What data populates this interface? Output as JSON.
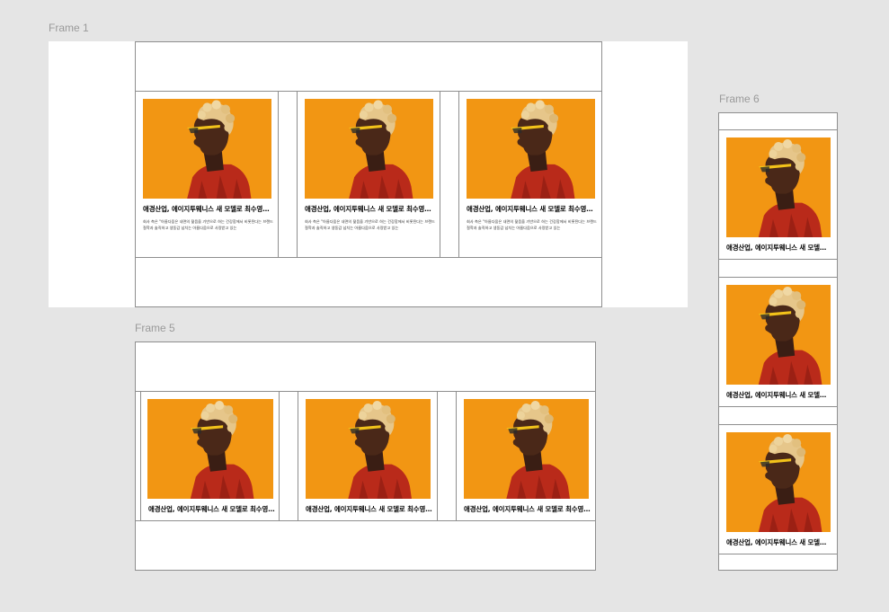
{
  "canvas": {
    "background": "#e5e5e5",
    "label_color": "#9a9a9a",
    "border_color": "#8e8e8e"
  },
  "frames": {
    "frame1": {
      "label": "Frame 1",
      "cards": [
        {
          "image": "person-profile-orange-background",
          "title": "애경산업, 에이지투웨니스 새 모델로 최수영…",
          "description": "회사 측은 \"아름다움은 내면의 젊음을 기반으로 하는 건강함에서 비롯된다는 브랜드 철학과 솔직하고 생동감 넘치는 아름다움으로 사랑받고 있는"
        },
        {
          "image": "person-profile-orange-background",
          "title": "애경산업, 에이지투웨니스 새 모델로 최수영…",
          "description": "회사 측은 \"아름다움은 내면의 젊음을 기반으로 하는 건강함에서 비롯된다는 브랜드 철학과 솔직하고 생동감 넘치는 아름다움으로 사랑받고 있는"
        },
        {
          "image": "person-profile-orange-background",
          "title": "애경산업, 에이지투웨니스 새 모델로 최수영…",
          "description": "회사 측은 \"아름다움은 내면의 젊음을 기반으로 하는 건강함에서 비롯된다는 브랜드 철학과 솔직하고 생동감 넘치는 아름다움으로 사랑받고 있는"
        }
      ]
    },
    "frame5": {
      "label": "Frame 5",
      "cards": [
        {
          "image": "person-profile-orange-background",
          "title": "애경산업, 에이지투웨니스 새 모델로 최수영…"
        },
        {
          "image": "person-profile-orange-background",
          "title": "애경산업, 에이지투웨니스 새 모델로 최수영…"
        },
        {
          "image": "person-profile-orange-background",
          "title": "애경산업, 에이지투웨니스 새 모델로 최수영…"
        }
      ]
    },
    "frame6": {
      "label": "Frame 6",
      "cards": [
        {
          "image": "person-profile-orange-background",
          "title": "애경산업, 에이지투웨니스 새 모델…"
        },
        {
          "image": "person-profile-orange-background",
          "title": "애경산업, 에이지투웨니스 새 모델…"
        },
        {
          "image": "person-profile-orange-background",
          "title": "애경산업, 에이지투웨니스 새 모델…"
        }
      ]
    }
  }
}
